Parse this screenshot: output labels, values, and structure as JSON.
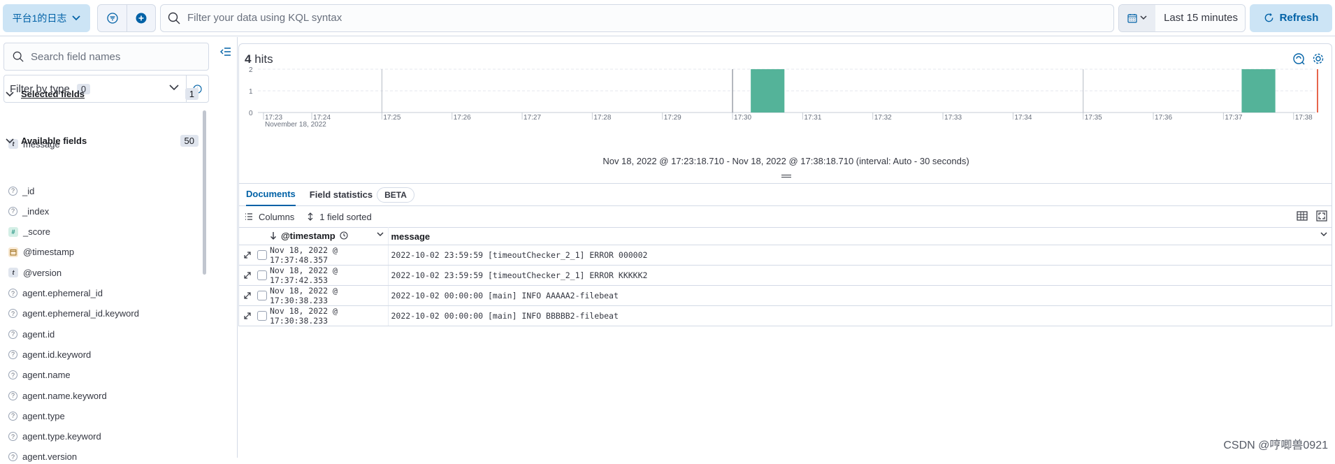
{
  "topbar": {
    "data_view": "平台1的日志",
    "query_placeholder": "Filter your data using KQL syntax",
    "time_range": "Last 15 minutes",
    "refresh_label": "Refresh"
  },
  "sidebar": {
    "search_placeholder": "Search field names",
    "filter_by_type_label": "Filter by type",
    "filter_by_type_count": "0",
    "selected_fields_label": "Selected fields",
    "selected_fields_count": "1",
    "selected_fields": [
      {
        "name": "message",
        "type": "t"
      }
    ],
    "available_fields_label": "Available fields",
    "available_fields_count": "50",
    "available_fields": [
      {
        "name": "_id",
        "type": "?"
      },
      {
        "name": "_index",
        "type": "?"
      },
      {
        "name": "_score",
        "type": "#"
      },
      {
        "name": "@timestamp",
        "type": "date"
      },
      {
        "name": "@version",
        "type": "t"
      },
      {
        "name": "agent.ephemeral_id",
        "type": "?"
      },
      {
        "name": "agent.ephemeral_id.keyword",
        "type": "?"
      },
      {
        "name": "agent.id",
        "type": "?"
      },
      {
        "name": "agent.id.keyword",
        "type": "?"
      },
      {
        "name": "agent.name",
        "type": "?"
      },
      {
        "name": "agent.name.keyword",
        "type": "?"
      },
      {
        "name": "agent.type",
        "type": "?"
      },
      {
        "name": "agent.type.keyword",
        "type": "?"
      },
      {
        "name": "agent.version",
        "type": "?"
      }
    ]
  },
  "histogram": {
    "hits_count": "4",
    "hits_label": "hits",
    "interval_text": "Nov 18, 2022 @ 17:23:18.710 - Nov 18, 2022 @ 17:38:18.710 (interval: Auto - 30 seconds)",
    "bar_color": "#54b399",
    "chart_data": {
      "type": "bar",
      "x_ticks": [
        "17:23",
        "17:24",
        "17:25",
        "17:26",
        "17:27",
        "17:28",
        "17:29",
        "17:30",
        "17:31",
        "17:32",
        "17:33",
        "17:34",
        "17:35",
        "17:36",
        "17:37",
        "17:38"
      ],
      "x_sublabel": "November 18, 2022",
      "y_ticks": [
        "0",
        "1",
        "2"
      ],
      "ylim": [
        0,
        2
      ],
      "bars": [
        {
          "x": "17:30:30",
          "value": 2
        },
        {
          "x": "17:37:30",
          "value": 2
        }
      ]
    }
  },
  "tabs": {
    "documents": "Documents",
    "field_statistics": "Field statistics",
    "beta": "BETA"
  },
  "toolbar": {
    "columns_label": "Columns",
    "sorted_label": "1 field sorted"
  },
  "grid": {
    "columns": [
      "@timestamp",
      "message"
    ],
    "rows": [
      {
        "timestamp": "Nov 18, 2022 @ 17:37:48.357",
        "message": "2022-10-02 23:59:59 [timeoutChecker_2_1] ERROR 000002"
      },
      {
        "timestamp": "Nov 18, 2022 @ 17:37:42.353",
        "message": "2022-10-02 23:59:59 [timeoutChecker_2_1] ERROR KKKKK2"
      },
      {
        "timestamp": "Nov 18, 2022 @ 17:30:38.233",
        "message": "2022-10-02 00:00:00 [main] INFO AAAAA2-filebeat"
      },
      {
        "timestamp": "Nov 18, 2022 @ 17:30:38.233",
        "message": "2022-10-02 00:00:00 [main] INFO BBBBB2-filebeat"
      }
    ]
  },
  "watermark": "CSDN @哼唧兽0921"
}
